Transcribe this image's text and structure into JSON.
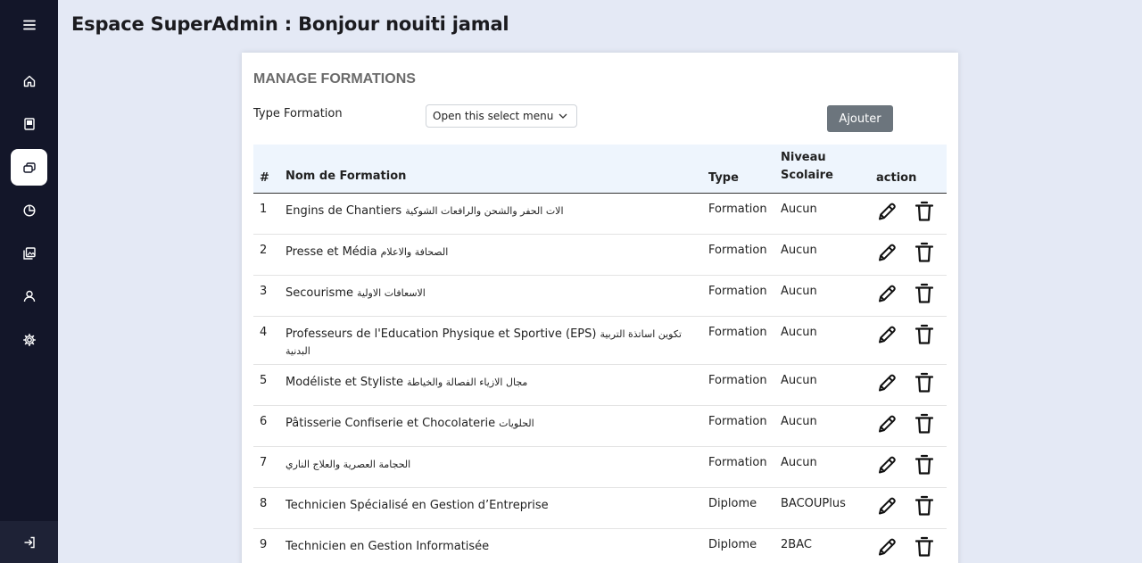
{
  "header": {
    "title": "Espace SuperAdmin : Bonjour nouiti jamal"
  },
  "sidebar": {
    "items": [
      {
        "icon": "menu-icon"
      },
      {
        "icon": "home-icon"
      },
      {
        "icon": "book-icon"
      },
      {
        "icon": "formations-icon",
        "active": true
      },
      {
        "icon": "pie-chart-icon"
      },
      {
        "icon": "gallery-icon"
      },
      {
        "icon": "user-icon"
      },
      {
        "icon": "gear-icon"
      }
    ],
    "logout_icon": "logout-icon"
  },
  "card": {
    "title": "MANAGE FORMATIONS",
    "filter_label": "Type Formation",
    "select_value": "Open this select menu",
    "add_button": "Ajouter",
    "columns": {
      "num": "#",
      "name": "Nom de Formation",
      "type": "Type",
      "niveau": "Niveau Scolaire",
      "action": "action"
    },
    "rows": [
      {
        "num": "1",
        "name": "Engins de Chantiers",
        "name_ar": "الات الحفر والشحن والرافعات الشوكية",
        "type": "Formation",
        "niveau": "Aucun"
      },
      {
        "num": "2",
        "name": "Presse et Média",
        "name_ar": "الصحافة والاعلام",
        "type": "Formation",
        "niveau": "Aucun"
      },
      {
        "num": "3",
        "name": "Secourisme",
        "name_ar": "الاسعافات الاولية",
        "type": "Formation",
        "niveau": "Aucun"
      },
      {
        "num": "4",
        "name": "Professeurs de l'Education Physique et Sportive (EPS)",
        "name_ar": "تكوين اساتذة التربية البدنية",
        "type": "Formation",
        "niveau": "Aucun"
      },
      {
        "num": "5",
        "name": "Modéliste et Styliste",
        "name_ar": "مجال الازياء الفصالة والخياطة",
        "type": "Formation",
        "niveau": "Aucun"
      },
      {
        "num": "6",
        "name": "Pâtisserie Confiserie et Chocolaterie",
        "name_ar": "الحلويات",
        "type": "Formation",
        "niveau": "Aucun"
      },
      {
        "num": "7",
        "name": "",
        "name_ar": "الحجامة العصرية والعلاج الناري",
        "type": "Formation",
        "niveau": "Aucun"
      },
      {
        "num": "8",
        "name": "Technicien Spécialisé en Gestion d’Entreprise",
        "name_ar": "",
        "type": "Diplome",
        "niveau": "BACOUPlus"
      },
      {
        "num": "9",
        "name": "Technicien en Gestion Informatisée",
        "name_ar": "",
        "type": "Diplome",
        "niveau": "2BAC"
      }
    ],
    "row_actions": [
      "pencil-icon",
      "trash-icon"
    ]
  },
  "colors": {
    "sidebar_bg": "#131629",
    "page_bg": "#e4e9f5",
    "header_row_bg": "#eef5fd",
    "add_button_bg": "#6c757d"
  }
}
